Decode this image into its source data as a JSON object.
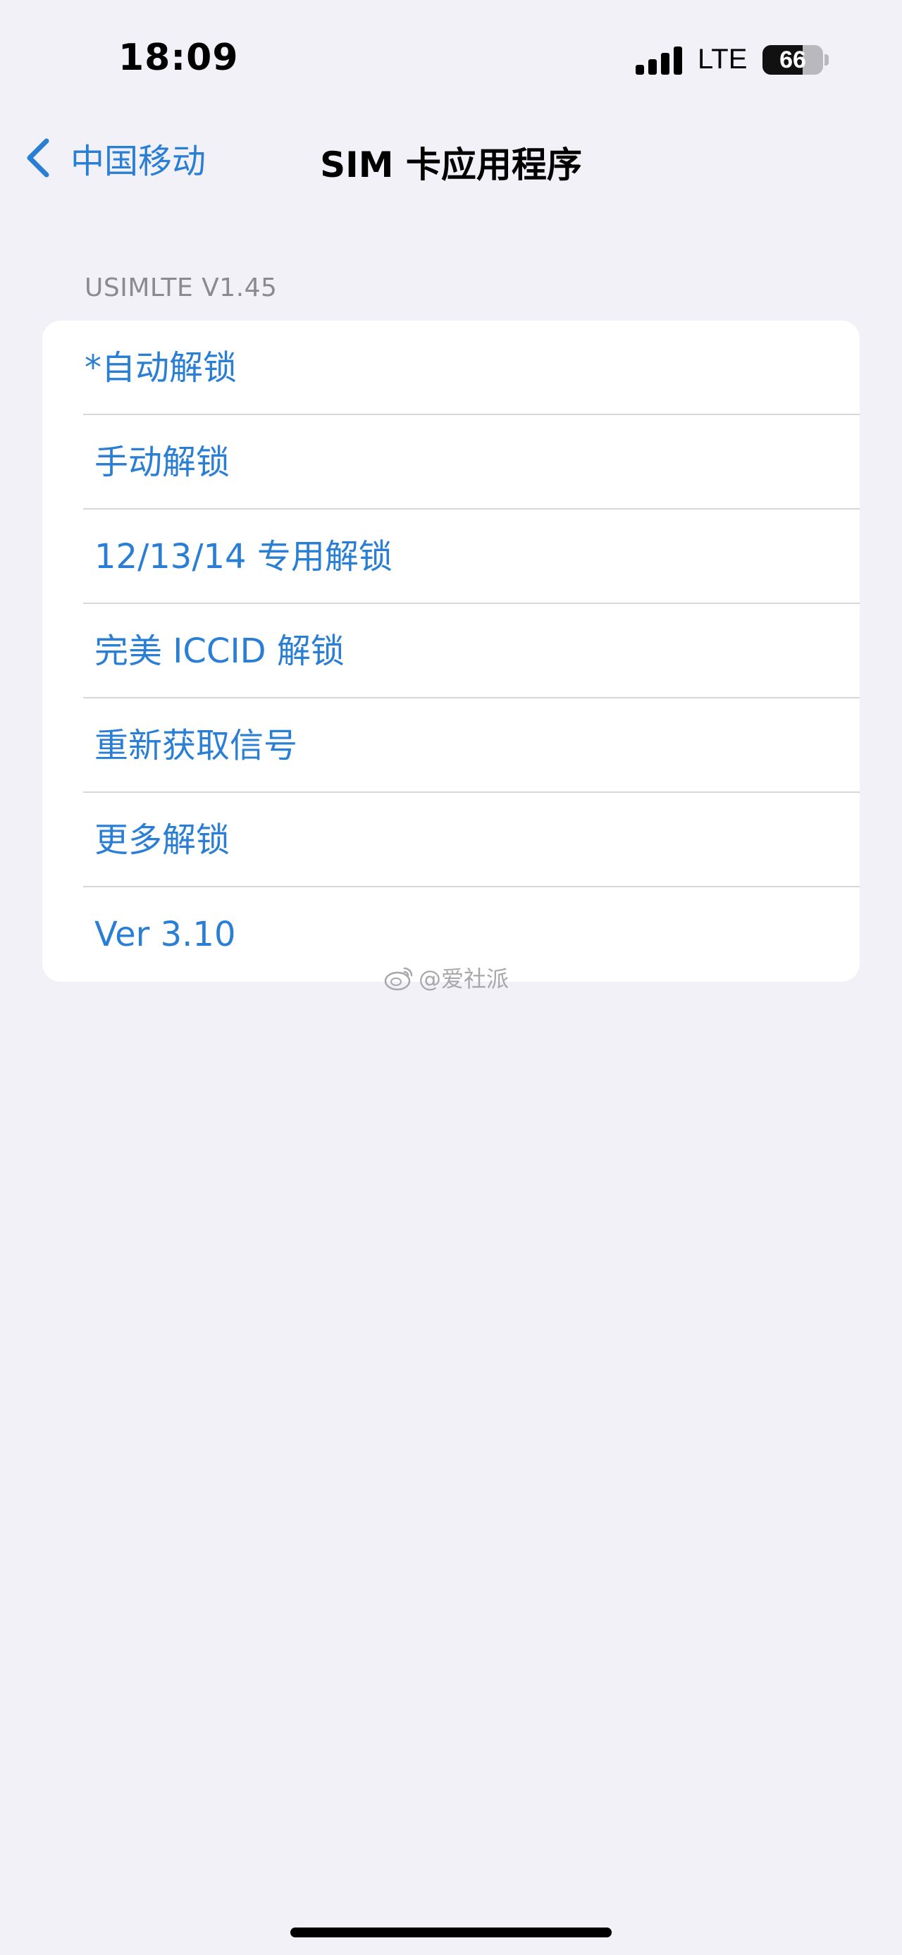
{
  "status_bar": {
    "time": "18:09",
    "network": "LTE",
    "battery_level": "66",
    "battery_fraction": 0.66,
    "signal_bars": 4
  },
  "nav": {
    "back_label": "中国移动",
    "title": "SIM 卡应用程序",
    "back_icon": "chevron-left-icon"
  },
  "section": {
    "header": "USIMLTE V1.45"
  },
  "menu": {
    "items": [
      {
        "label": "*自动解锁"
      },
      {
        "label": "手动解锁"
      },
      {
        "label": "12/13/14 专用解锁"
      },
      {
        "label": "完美 ICCID 解锁"
      },
      {
        "label": "重新获取信号"
      },
      {
        "label": "更多解锁"
      },
      {
        "label": "Ver 3.10"
      }
    ]
  },
  "watermark": {
    "text": "@爱社派",
    "icon": "weibo-icon"
  },
  "colors": {
    "accent": "#2a7fd4",
    "background": "#f2f1f7",
    "card": "#ffffff",
    "section_header": "#8a8a8f",
    "separator": "#d6d6db"
  }
}
